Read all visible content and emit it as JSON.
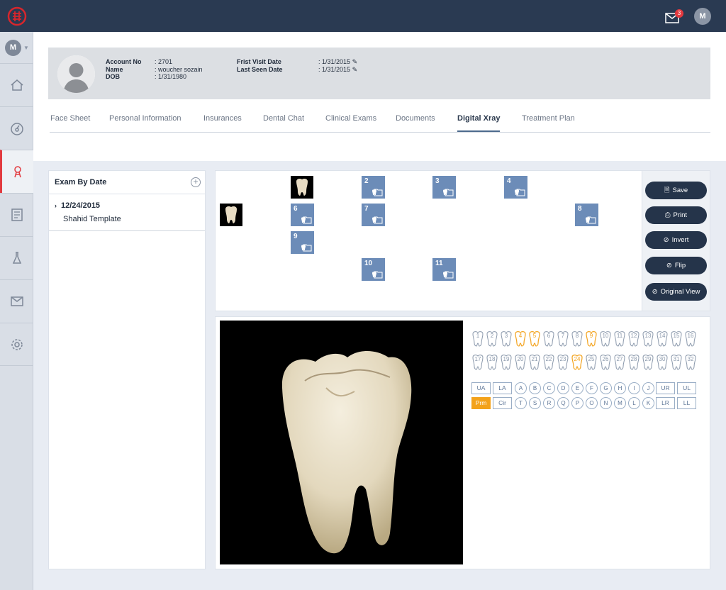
{
  "topbar": {
    "mail_badge": "3",
    "user_initial": "M"
  },
  "sidebar": {
    "user_initial": "M",
    "items": [
      "home-icon",
      "dashboard-icon",
      "patient-icon",
      "billing-icon",
      "lab-icon",
      "mail-icon",
      "gear-icon"
    ]
  },
  "patient": {
    "account_label": "Account No",
    "account_value": ": 2701",
    "name_label": "Name",
    "name_value": ": woucher sozain",
    "dob_label": "DOB",
    "dob_value": ": 1/31/1980",
    "first_visit_label": "Frist Visit Date",
    "first_visit_value": ": 1/31/2015",
    "last_seen_label": "Last Seen Date",
    "last_seen_value": ": 1/31/2015"
  },
  "tabs": [
    "Face Sheet",
    "Personal Information",
    "Insurances",
    "Dental Chat",
    "Clinical Exams",
    "Documents",
    "Digital Xray",
    "Treatment Plan"
  ],
  "active_tab": "Digital Xray",
  "exam": {
    "title": "Exam By Date",
    "date": "12/24/2015",
    "template": "Shahid Template"
  },
  "thumbs": [
    "2",
    "3",
    "4",
    "6",
    "7",
    "8",
    "9",
    "10",
    "11"
  ],
  "actions": {
    "save": "Save",
    "print": "Print",
    "invert": "Invert",
    "flip": "Flip",
    "original": "Original View"
  },
  "teeth_upper": [
    "1",
    "2",
    "3",
    "4",
    "5",
    "6",
    "7",
    "8",
    "9",
    "10",
    "11",
    "12",
    "13",
    "14",
    "15",
    "16"
  ],
  "teeth_lower": [
    "17",
    "18",
    "19",
    "20",
    "21",
    "22",
    "23",
    "24",
    "25",
    "26",
    "27",
    "28",
    "29",
    "30",
    "31",
    "32"
  ],
  "selected_teeth": [
    "4",
    "5",
    "9",
    "24"
  ],
  "regions_row1": [
    "UA",
    "LA",
    "A",
    "B",
    "C",
    "D",
    "E",
    "F",
    "G",
    "H",
    "I",
    "J",
    "UR",
    "UL"
  ],
  "regions_row2": [
    "Prm",
    "Cir",
    "T",
    "S",
    "R",
    "Q",
    "P",
    "O",
    "N",
    "M",
    "L",
    "K",
    "LR",
    "LL"
  ],
  "colors": {
    "accent": "#f3a21b",
    "navy": "#25344a",
    "thumb_blue": "#6c8cb8",
    "active_red": "#e23a3f"
  }
}
